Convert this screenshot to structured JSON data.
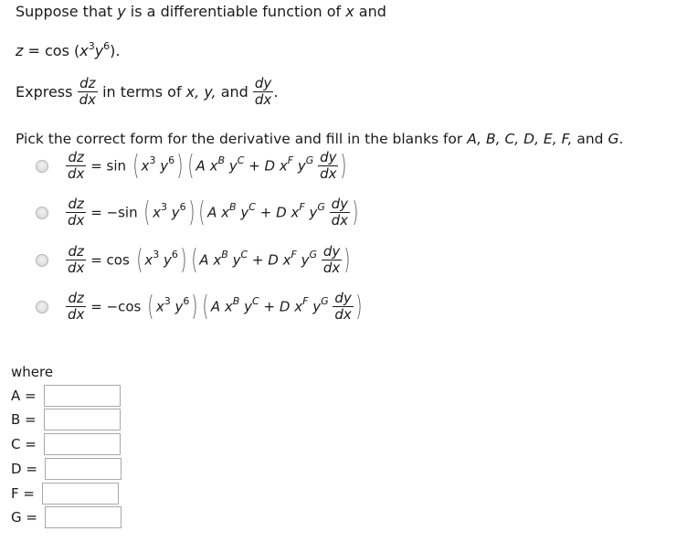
{
  "intro": {
    "line1_a": "Suppose that ",
    "line1_y": "y",
    "line1_b": " is a differentiable function of ",
    "line1_x": "x",
    "line1_c": " and",
    "z_var": "z",
    "z_eq": " = cos (",
    "z_x": "x",
    "z_x_exp": "3",
    "z_y": "y",
    "z_y_exp": "6",
    "z_close": ")."
  },
  "express": {
    "prefix": "Express",
    "frac1_num": "dz",
    "frac1_den": "dx",
    "middle": " in terms of ",
    "vars": "x, y,",
    "and": " and ",
    "frac2_num": "dy",
    "frac2_den": "dx",
    "suffix": "."
  },
  "instruction": {
    "text": "Pick the correct form for the derivative and fill in the blanks for ",
    "letters": "A, B, C, D, E, F,",
    "and": " and ",
    "last": "G",
    "period": "."
  },
  "options": [
    {
      "func": "sin",
      "selected": false
    },
    {
      "func": "−sin",
      "selected": false
    },
    {
      "func": "cos",
      "selected": false
    },
    {
      "func": "−cos",
      "selected": false
    }
  ],
  "formula": {
    "lhs_num": "dz",
    "lhs_den": "dx",
    "eq": "=",
    "x": "x",
    "x_exp": "3",
    "y": "y",
    "y_exp": "6",
    "A": "A",
    "xB": "x",
    "B": "B",
    "yC": "y",
    "C": "C",
    "plus": "+",
    "D": "D",
    "xF": "x",
    "F": "F",
    "yG": "y",
    "G": "G",
    "dy_num": "dy",
    "dy_den": "dx"
  },
  "where": {
    "label": "where",
    "fields": [
      {
        "label": "A =",
        "value": ""
      },
      {
        "label": "B =",
        "value": ""
      },
      {
        "label": "C =",
        "value": ""
      },
      {
        "label": "D =",
        "value": ""
      },
      {
        "label": "F =",
        "value": ""
      },
      {
        "label": "G =",
        "value": ""
      }
    ]
  }
}
